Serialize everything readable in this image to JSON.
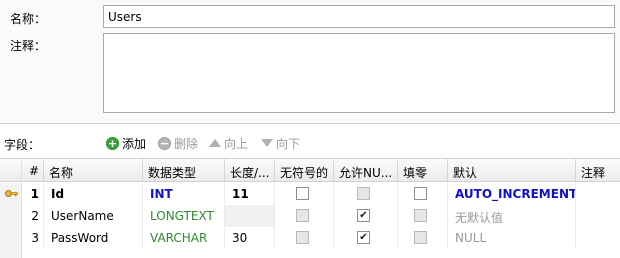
{
  "form": {
    "name_label": "名称：",
    "name_value": "Users",
    "comment_label": "注释："
  },
  "toolbar": {
    "fields_label": "字段：",
    "add_label": "添加",
    "delete_label": "删除",
    "up_label": "向上",
    "down_label": "向下"
  },
  "grid": {
    "columns": [
      "#",
      "名称",
      "数据类型",
      "长度/...",
      "无符号的",
      "允许NU...",
      "填零",
      "默认",
      "注释"
    ],
    "rows": [
      {
        "num": "1",
        "name": "Id",
        "type": "INT",
        "length": "11",
        "default": "AUTO_INCREMENT",
        "unsigned": false,
        "allow_null": false,
        "zerofill": false
      },
      {
        "num": "2",
        "name": "UserName",
        "type": "LONGTEXT",
        "length": "",
        "default": "无默认值",
        "unsigned": false,
        "allow_null": true,
        "zerofill": false
      },
      {
        "num": "3",
        "name": "PassWord",
        "type": "VARCHAR",
        "length": "30",
        "default": "NULL",
        "unsigned": false,
        "allow_null": true,
        "zerofill": false
      }
    ]
  },
  "colors": {
    "type_blue": "#1010c8",
    "type_green": "#2e8b2e",
    "add_green": "#3aa53a",
    "key_gold": "#d9a520"
  },
  "icons": {
    "add": "plus-circle-icon",
    "delete": "minus-circle-icon",
    "up": "triangle-up-icon",
    "down": "triangle-down-icon",
    "primary_key": "key-icon"
  }
}
